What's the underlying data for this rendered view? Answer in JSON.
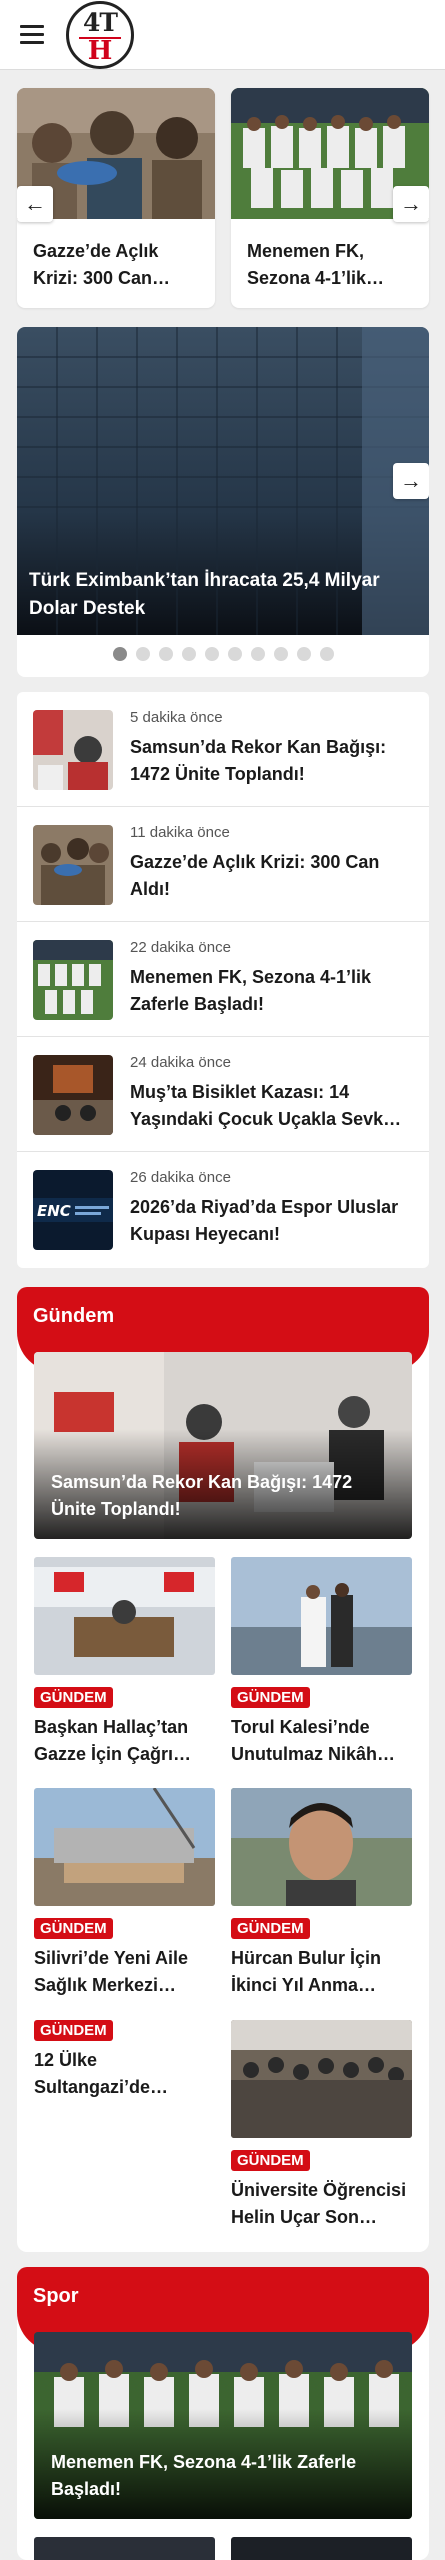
{
  "header": {
    "menu_icon": "hamburger-icon",
    "logo_top": "4T",
    "logo_bottom": "H"
  },
  "top_cards": [
    {
      "title": "Gazze’de Açlık Krizi: 300 Can…"
    },
    {
      "title": "Menemen FK, Sezona 4-1’lik…"
    }
  ],
  "hero": {
    "title": "Türk Eximbank’tan İhracata 25,4 Milyar Dolar Destek",
    "dot_count": 10,
    "active_dot": 1
  },
  "latest": [
    {
      "time": "5 dakika önce",
      "title": "Samsun’da Rekor Kan Bağışı: 1472 Ünite Toplandı!"
    },
    {
      "time": "11 dakika önce",
      "title": "Gazze’de Açlık Krizi: 300 Can Aldı!"
    },
    {
      "time": "22 dakika önce",
      "title": "Menemen FK, Sezona 4-1’lik Zaferle Başladı!"
    },
    {
      "time": "24 dakika önce",
      "title": "Muş’ta Bisiklet Kazası: 14 Yaşındaki Çocuk Uçakla Sevk…"
    },
    {
      "time": "26 dakika önce",
      "title": "2026’da Riyad’da Espor Uluslar Kupası Heyecanı!"
    }
  ],
  "gundem": {
    "label": "Gündem",
    "feature_title": "Samsun’da Rekor Kan Bağışı: 1472 Ünite Toplandı!",
    "items": [
      {
        "badge": "GÜNDEM",
        "title": "Başkan Hallaç’tan Gazze İçin Çağrı…"
      },
      {
        "badge": "GÜNDEM",
        "title": "Torul Kalesi’nde Unutulmaz Nikâh…"
      },
      {
        "badge": "GÜNDEM",
        "title": "Silivri’de Yeni Aile Sağlık Merkezi…"
      },
      {
        "badge": "GÜNDEM",
        "title": "Hürcan Bulur İçin İkinci Yıl Anma…"
      },
      {
        "badge": "GÜNDEM",
        "title": "12 Ülke Sultangazi’de…"
      },
      {
        "badge": "GÜNDEM",
        "title": "Üniversite Öğrencisi Helin Uçar Son…"
      }
    ]
  },
  "spor": {
    "label": "Spor",
    "feature_title": "Menemen FK, Sezona 4-1’lik Zaferle Başladı!"
  },
  "colors": {
    "accent": "#d40d15",
    "background": "#eeeeee"
  }
}
